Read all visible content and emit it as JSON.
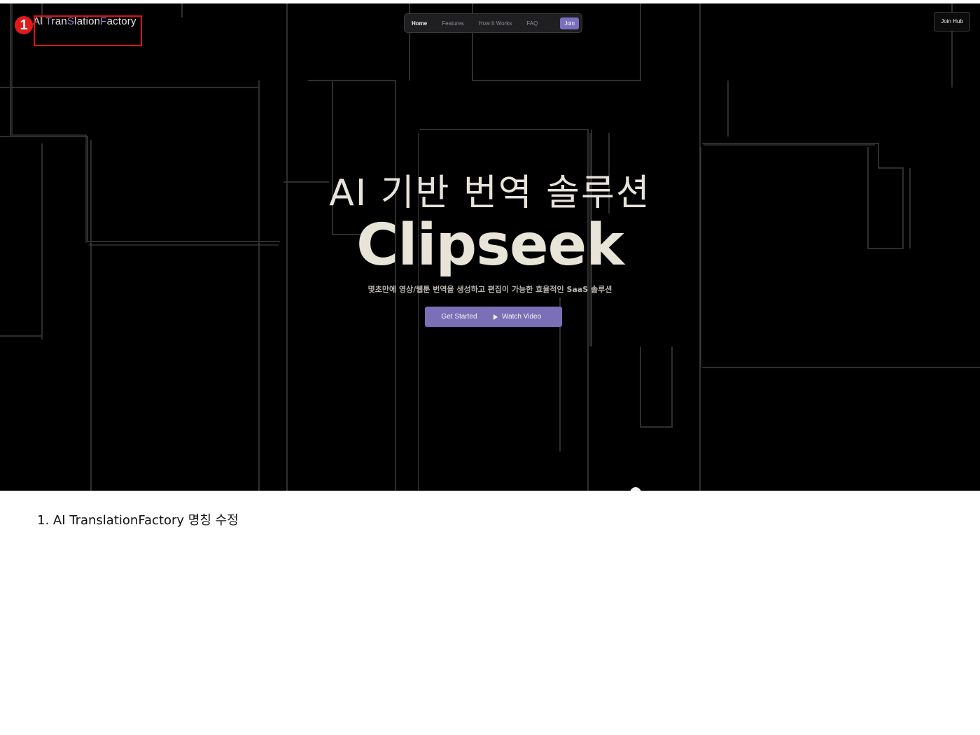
{
  "logo": {
    "parts": [
      {
        "text": "Al ",
        "hl": false
      },
      {
        "text": "T",
        "hl": true
      },
      {
        "text": "ran",
        "hl": false
      },
      {
        "text": "S",
        "hl": true
      },
      {
        "text": "lation",
        "hl": false
      },
      {
        "text": "F",
        "hl": true
      },
      {
        "text": "actory",
        "hl": false
      }
    ],
    "highlight_color": "#9c8fd8"
  },
  "annotation": {
    "badge": "1",
    "color": "#e01010"
  },
  "nav": {
    "items": [
      {
        "label": "Home",
        "active": true
      },
      {
        "label": "Features",
        "active": false
      },
      {
        "label": "How It Works",
        "active": false
      },
      {
        "label": "FAQ",
        "active": false
      }
    ],
    "join_label": "Join"
  },
  "header": {
    "join_hub_label": "Join Hub"
  },
  "hero": {
    "headline": "AI 기반 번역 솔루션",
    "brand": "Clipseek",
    "subtitle": "몇초만에 영상/웹툰 번역을 생성하고 편집이 가능한 효율적인 SaaS 솔루션",
    "get_started_label": "Get Started",
    "watch_video_label": "Watch Video",
    "accent_color": "#7b70b8"
  },
  "caption": "1. AI TranslationFactory 명칭 수정"
}
